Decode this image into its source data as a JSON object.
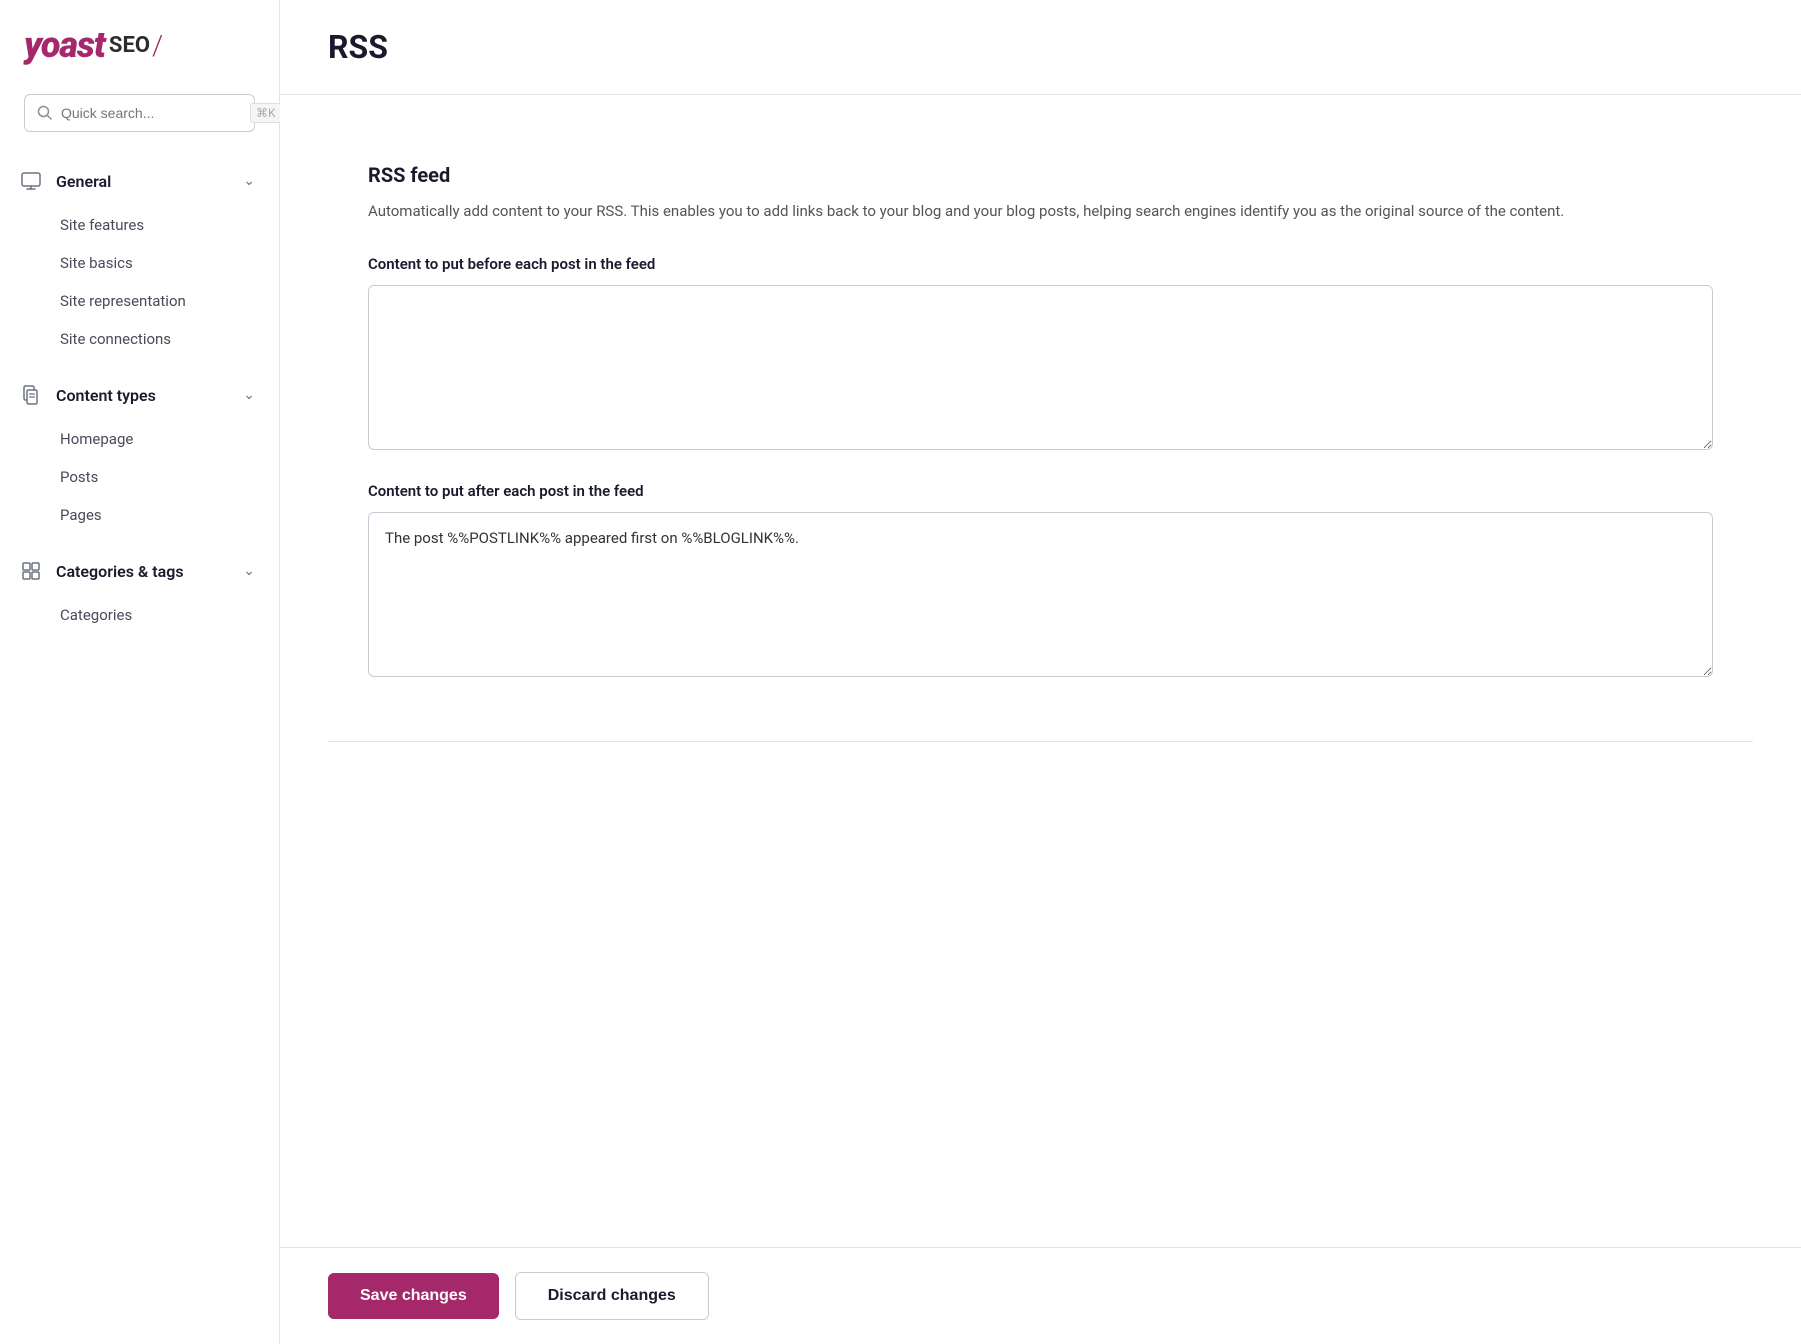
{
  "logo": {
    "yoast": "yoast",
    "seo": "SEO",
    "slash": "/"
  },
  "search": {
    "placeholder": "Quick search...",
    "shortcut": "⌘K"
  },
  "sidebar": {
    "sections": [
      {
        "id": "general",
        "icon": "monitor-icon",
        "title": "General",
        "expanded": true,
        "items": [
          {
            "id": "site-features",
            "label": "Site features"
          },
          {
            "id": "site-basics",
            "label": "Site basics"
          },
          {
            "id": "site-representation",
            "label": "Site representation"
          },
          {
            "id": "site-connections",
            "label": "Site connections"
          }
        ]
      },
      {
        "id": "content-types",
        "icon": "doc-icon",
        "title": "Content types",
        "expanded": true,
        "items": [
          {
            "id": "homepage",
            "label": "Homepage"
          },
          {
            "id": "posts",
            "label": "Posts"
          },
          {
            "id": "pages",
            "label": "Pages"
          }
        ]
      },
      {
        "id": "categories-tags",
        "icon": "tag-icon",
        "title": "Categories & tags",
        "expanded": true,
        "items": [
          {
            "id": "categories",
            "label": "Categories"
          }
        ]
      }
    ]
  },
  "page": {
    "title": "RSS"
  },
  "rss_feed": {
    "section_title": "RSS feed",
    "description": "Automatically add content to your RSS. This enables you to add links back to your blog and your blog posts, helping search engines identify you as the original source of the content.",
    "before_label": "Content to put before each post in the feed",
    "before_value": "",
    "after_label": "Content to put after each post in the feed",
    "after_value": "The post %%POSTLINK%% appeared first on %%BLOGLINK%%."
  },
  "buttons": {
    "save": "Save changes",
    "discard": "Discard changes"
  }
}
